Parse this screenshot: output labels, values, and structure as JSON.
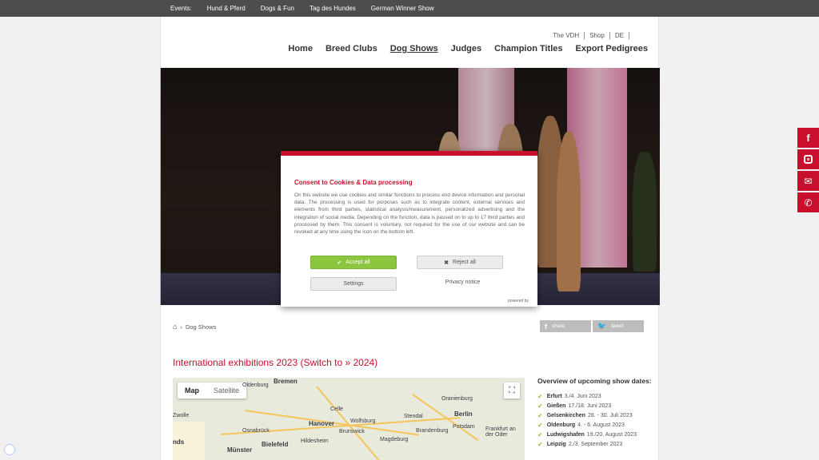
{
  "topbar": {
    "label": "Events:",
    "events": [
      "Hund & Pferd",
      "Dogs & Fun",
      "Tag des Hundes",
      "German Winner Show"
    ]
  },
  "meta_links": [
    "The VDH",
    "Shop",
    "DE"
  ],
  "nav": [
    "Home",
    "Breed Clubs",
    "Dog Shows",
    "Judges",
    "Champion Titles",
    "Export Pedigrees"
  ],
  "consent": {
    "title": "Consent to Cookies & Data processing",
    "body": "On this website we use cookies and similar functions to process end device information and personal data. The processing is used for purposes such as to integrate content, external services and elements from third parties, statistical analysis/measurement, personalized advertising and the integration of social media. Depending on the function, data is passed on to up to 17 third parties and processed by them. This consent is voluntary, not required for the use of our website and can be revoked at any time using the icon on the bottom left.",
    "accept": "Accept all",
    "reject": "Reject all",
    "settings": "Settings",
    "privacy": "Privacy notice",
    "powered": "powered by"
  },
  "breadcrumb": "Dog Shows",
  "share": {
    "share": "share",
    "tweet": "tweet"
  },
  "heading": "International exhibitions 2023 (Switch to » 2024)",
  "map": {
    "map_label": "Map",
    "satellite_label": "Satellite",
    "cities": [
      "Oldenburg",
      "Bremen",
      "Celle",
      "Wolfsburg",
      "Hanover",
      "Osnabrück",
      "Bielefeld",
      "Hildesheim",
      "Brunswick",
      "Magdeburg",
      "Berlin",
      "Potsdam",
      "Brandenburg",
      "Oranienburg",
      "Frankfurt an der Oder",
      "Münster",
      "Zwolle",
      "nds",
      "Stendal"
    ]
  },
  "overview": {
    "title": "Overview of upcoming show dates:",
    "shows": [
      {
        "city": "Erfurt",
        "date": "3./4. Juni 2023"
      },
      {
        "city": "Gießen",
        "date": "17./18. Juni 2023"
      },
      {
        "city": "Gelsenkirchen",
        "date": "28. - 30. Juli 2023"
      },
      {
        "city": "Oldenburg",
        "date": "4. - 6. August 2023"
      },
      {
        "city": "Ludwigshafen",
        "date": "19./20. August 2023"
      },
      {
        "city": "Leipzig",
        "date": "2./3. September 2023"
      }
    ]
  }
}
